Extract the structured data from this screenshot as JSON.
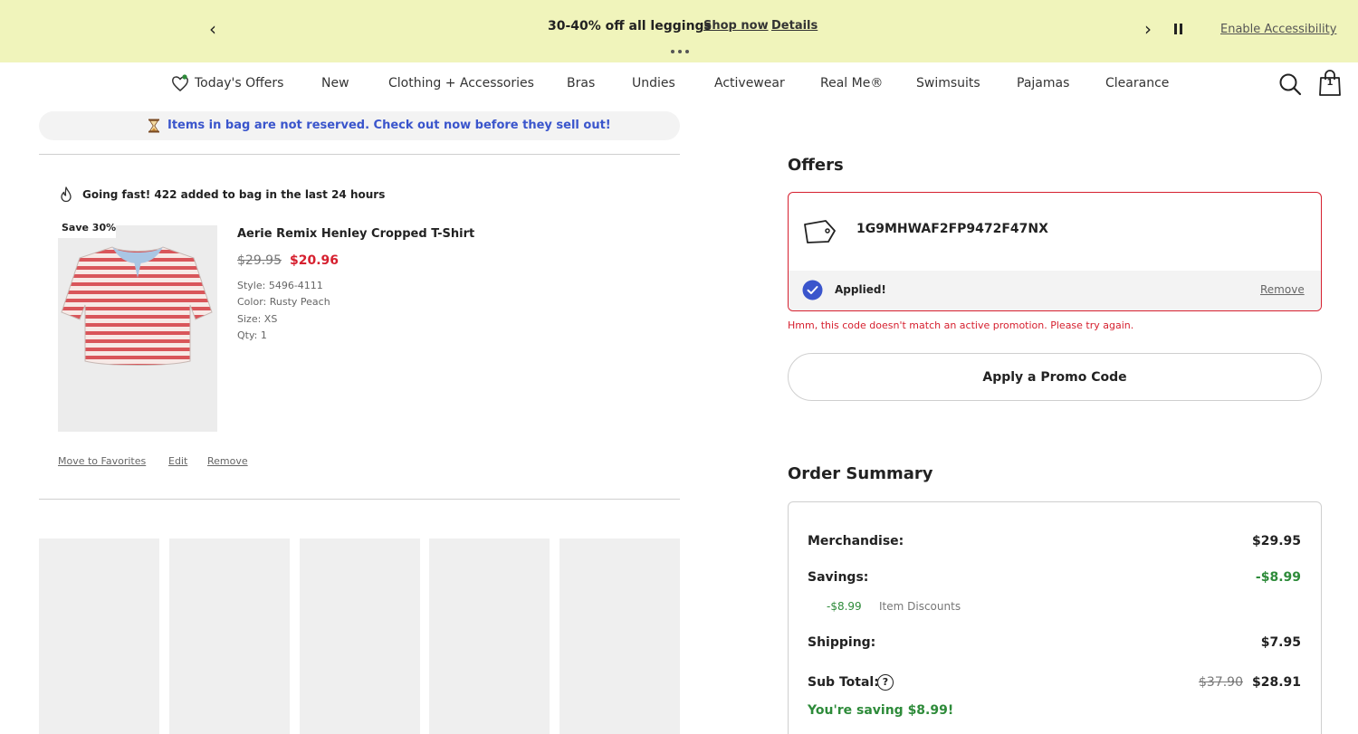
{
  "promo_banner": {
    "message": "30-40% off all leggings",
    "shop_now": "Shop now",
    "details": "Details",
    "prev_icon": "‹",
    "next_icon": "›",
    "accessibility": "Enable Accessibility"
  },
  "nav": {
    "items": [
      "Today's Offers",
      "New",
      "Clothing + Accessories",
      "Bras",
      "Undies",
      "Activewear",
      "Real Me®",
      "Swimsuits",
      "Pajamas",
      "Clearance"
    ],
    "bag_count": "1"
  },
  "bag": {
    "notice": "Items in bag are not reserved. Check out now before they sell out!",
    "going_fast": "Going fast! 422 added to bag in the last 24 hours",
    "item": {
      "badge": "Save 30%",
      "name": "Aerie Remix Henley Cropped T-Shirt",
      "original_price": "$29.95",
      "sale_price": "$20.96",
      "style": "Style: 5496-4111",
      "color": "Color: Rusty Peach",
      "size": "Size: XS",
      "qty": "Qty: 1",
      "actions": [
        "Move to Favorites",
        "Edit",
        "Remove"
      ]
    }
  },
  "offers": {
    "title": "Offers",
    "code": "1G9MHWAF2FP9472F47NX",
    "status": "Applied!",
    "remove": "Remove",
    "error": "Hmm, this code doesn't match an active promotion. Please try again.",
    "apply_button": "Apply a Promo Code"
  },
  "order_summary": {
    "title": "Order Summary",
    "merchandise_label": "Merchandise:",
    "merchandise_value": "$29.95",
    "savings_label": "Savings:",
    "savings_value": "-$8.99",
    "item_discount_value": "-$8.99",
    "item_discount_label": "Item Discounts",
    "shipping_label": "Shipping:",
    "shipping_value": "$7.95",
    "subtotal_label": "Sub Total:",
    "subtotal_help": "?",
    "subtotal_original": "$37.90",
    "subtotal_value": "$28.91",
    "saving_message": "You're saving $8.99!"
  },
  "colors": {
    "banner_bg": "#f0f4bb",
    "link_blue": "#3a55cc",
    "sale_red": "#d6202f",
    "savings_green": "#2e8b3a"
  }
}
